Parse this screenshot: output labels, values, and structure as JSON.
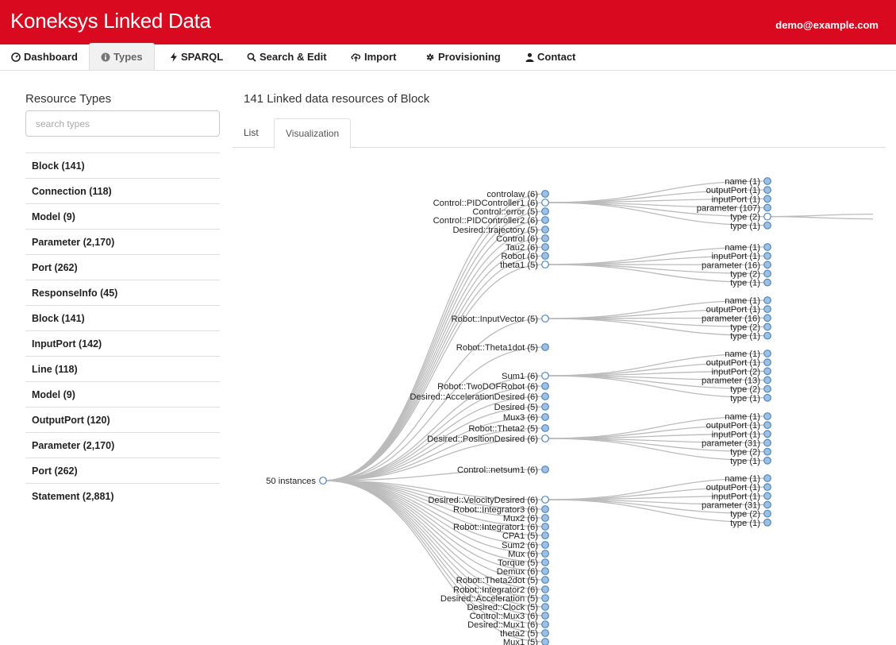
{
  "header": {
    "brand": "Koneksys Linked Data",
    "user_email": "demo@example.com",
    "brand_color": "#d9091f"
  },
  "nav": {
    "tabs": [
      {
        "label": "Dashboard",
        "icon": "dashboard-icon"
      },
      {
        "label": "Types",
        "icon": "info-icon",
        "active": true
      },
      {
        "label": "SPARQL",
        "icon": "lightning-icon"
      },
      {
        "label": "Search & Edit",
        "icon": "search-icon"
      },
      {
        "label": "Import",
        "icon": "cloud-upload-icon"
      },
      {
        "label": "Provisioning",
        "icon": "gear-icon"
      },
      {
        "label": "Contact",
        "icon": "user-icon"
      }
    ]
  },
  "sidebar": {
    "title": "Resource Types",
    "search_placeholder": "search types",
    "items": [
      "Block (141)",
      "Connection (118)",
      "Model (9)",
      "Parameter (2,170)",
      "Port (262)",
      "ResponseInfo (45)",
      "Block (141)",
      "InputPort (142)",
      "Line (118)",
      "Model (9)",
      "OutputPort (120)",
      "Parameter (2,170)",
      "Port (262)",
      "Statement (2,881)"
    ]
  },
  "main": {
    "title": "141 Linked data resources of Block",
    "tabs": [
      "List",
      "Visualization"
    ],
    "active_tab": "Visualization"
  },
  "tree": {
    "root": "50 instances",
    "children": [
      {
        "label": "controlaw (6)"
      },
      {
        "label": "Control::PIDController1 (6)",
        "expanded": true,
        "children": [
          "name (1)",
          "outputPort (1)",
          "inputPort (1)",
          "parameter (107)",
          {
            "label": "type (2)",
            "expanded": true
          },
          "type (1)"
        ]
      },
      {
        "label": "Control::error (5)"
      },
      {
        "label": "Control::PIDController2 (6)"
      },
      {
        "label": "Desired::trajectory (5)"
      },
      {
        "label": "Control (6)"
      },
      {
        "label": "Tau2 (6)"
      },
      {
        "label": "Robot (6)"
      },
      {
        "label": "theta1 (5)",
        "expanded": true,
        "children": [
          "name (1)",
          "inputPort (1)",
          "parameter (16)",
          "type (2)",
          "type (1)"
        ]
      },
      {
        "label": "Robot::InputVector (5)",
        "expanded": true,
        "children": [
          "name (1)",
          "outputPort (1)",
          "parameter (16)",
          "type (2)",
          "type (1)"
        ]
      },
      {
        "label": "Robot::Theta1dot (5)"
      },
      {
        "label": "Sum1 (6)",
        "expanded": true,
        "children": [
          "name (1)",
          "outputPort (1)",
          "inputPort (2)",
          "parameter (13)",
          "type (2)",
          "type (1)"
        ]
      },
      {
        "label": "Robot::TwoDOFRobot (6)"
      },
      {
        "label": "Desired::AccelerationDesired (6)"
      },
      {
        "label": "Desired (5)"
      },
      {
        "label": "Mux3 (6)"
      },
      {
        "label": "Robot::Theta2 (5)"
      },
      {
        "label": "Desired::PositionDesired (6)",
        "expanded": true,
        "children": [
          "name (1)",
          "outputPort (1)",
          "inputPort (1)",
          "parameter (31)",
          "type (2)",
          "type (1)"
        ]
      },
      {
        "label": "Control::netsum1 (6)"
      },
      {
        "label": "Desired::VelocityDesired (6)",
        "expanded": true,
        "children": [
          "name (1)",
          "outputPort (1)",
          "inputPort (1)",
          "parameter (31)",
          "type (2)",
          "type (1)"
        ]
      },
      {
        "label": "Robot::Integrator3 (6)"
      },
      {
        "label": "Mux2 (6)"
      },
      {
        "label": "Robot::Integrator1 (6)"
      },
      {
        "label": "CPA1 (5)"
      },
      {
        "label": "Sum2 (6)"
      },
      {
        "label": "Mux (6)"
      },
      {
        "label": "Torque (5)"
      },
      {
        "label": "Demux (6)"
      },
      {
        "label": "Robot::Theta2dot (5)"
      },
      {
        "label": "Robot::Integrator2 (6)"
      },
      {
        "label": "Desired::Acceleration (5)"
      },
      {
        "label": "Desired::Clock (5)"
      },
      {
        "label": "Control::Mux3 (6)"
      },
      {
        "label": "Desired::Mux1 (6)"
      },
      {
        "label": "theta2 (5)"
      },
      {
        "label": "Mux1 (5)"
      }
    ],
    "colors": {
      "link": "#bbbbbb",
      "leaf_fill": "#9ec0e2",
      "expanded_fill": "#ffffff",
      "node_stroke": "#4f86bd"
    }
  }
}
